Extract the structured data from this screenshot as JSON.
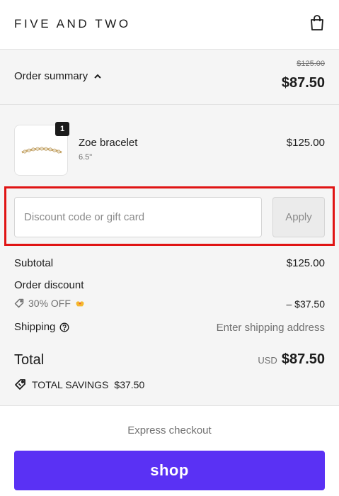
{
  "header": {
    "brand": "FIVE AND TWO",
    "cart_icon": "shopping-bag-icon"
  },
  "summary": {
    "toggle_label": "Order summary",
    "toggle_icon": "chevron-up-icon",
    "original_total": "$125.00",
    "total": "$87.50"
  },
  "line_items": [
    {
      "name": "Zoe bracelet",
      "variant": "6.5\"",
      "quantity": "1",
      "price": "$125.00"
    }
  ],
  "discount": {
    "placeholder": "Discount code or gift card",
    "value": "",
    "apply_label": "Apply"
  },
  "totals": {
    "subtotal_label": "Subtotal",
    "subtotal_value": "$125.00",
    "order_discount_label": "Order discount",
    "discount_code": "30% OFF",
    "discount_icon": "price-tag-icon",
    "discount_emoji_icon": "heart-hands-icon",
    "discount_value": "– $37.50",
    "shipping_label": "Shipping",
    "shipping_info_icon": "help-circle-icon",
    "shipping_value": "Enter shipping address",
    "total_label": "Total",
    "currency": "USD",
    "total_value": "$87.50",
    "savings_label": "TOTAL SAVINGS",
    "savings_value": "$37.50",
    "savings_icon": "savings-tag-icon"
  },
  "express": {
    "label": "Express checkout",
    "shop_button_label": "shop"
  },
  "colors": {
    "shop_purple": "#5a31f4",
    "highlight_red": "#e01414",
    "panel_grey": "#f5f5f5"
  }
}
